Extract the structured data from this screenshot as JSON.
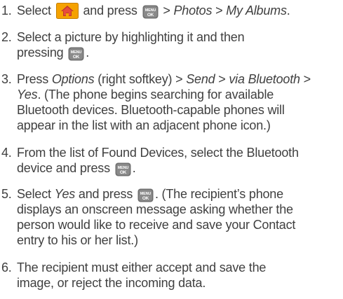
{
  "steps": [
    {
      "number": "1.",
      "parts": {
        "a": "Select",
        "b": "and press",
        "c": "> ",
        "d": "Photos",
        "e": " > ",
        "f": "My Albums",
        "g": "."
      }
    },
    {
      "number": "2.",
      "parts": {
        "a": "Select a picture by highlighting it and then",
        "b": "pressing",
        "c": "."
      }
    },
    {
      "number": "3.",
      "parts": {
        "a": "Press ",
        "b": "Options",
        "c": " (right softkey) > ",
        "d": "Send",
        "e": " > ",
        "f": "via Bluetooth",
        "g": " >",
        "h": "Yes",
        "i": ". (The phone begins searching for available",
        "j": "Bluetooth devices. Bluetooth-capable phones will",
        "k": "appear in the list with an adjacent phone icon.)"
      }
    },
    {
      "number": "4.",
      "parts": {
        "a": "From the list of Found Devices, select the Bluetooth",
        "b": "device and press",
        "c": "."
      }
    },
    {
      "number": "5.",
      "parts": {
        "a": "Select ",
        "b": "Yes",
        "c": " and press",
        "d": ". (The recipient’s phone",
        "e": "displays an onscreen message asking whether the",
        "f": "person would like to receive and save your Contact",
        "g": "entry to his or her list.)"
      }
    },
    {
      "number": "6.",
      "parts": {
        "a": "The recipient must either accept and save the",
        "b": "image, or reject the incoming data."
      }
    }
  ],
  "icons": {
    "menu_ok_top": "MENU",
    "menu_ok_bottom": "OK",
    "home_color": "#f5a200",
    "home_roof_color": "#c0392b"
  }
}
